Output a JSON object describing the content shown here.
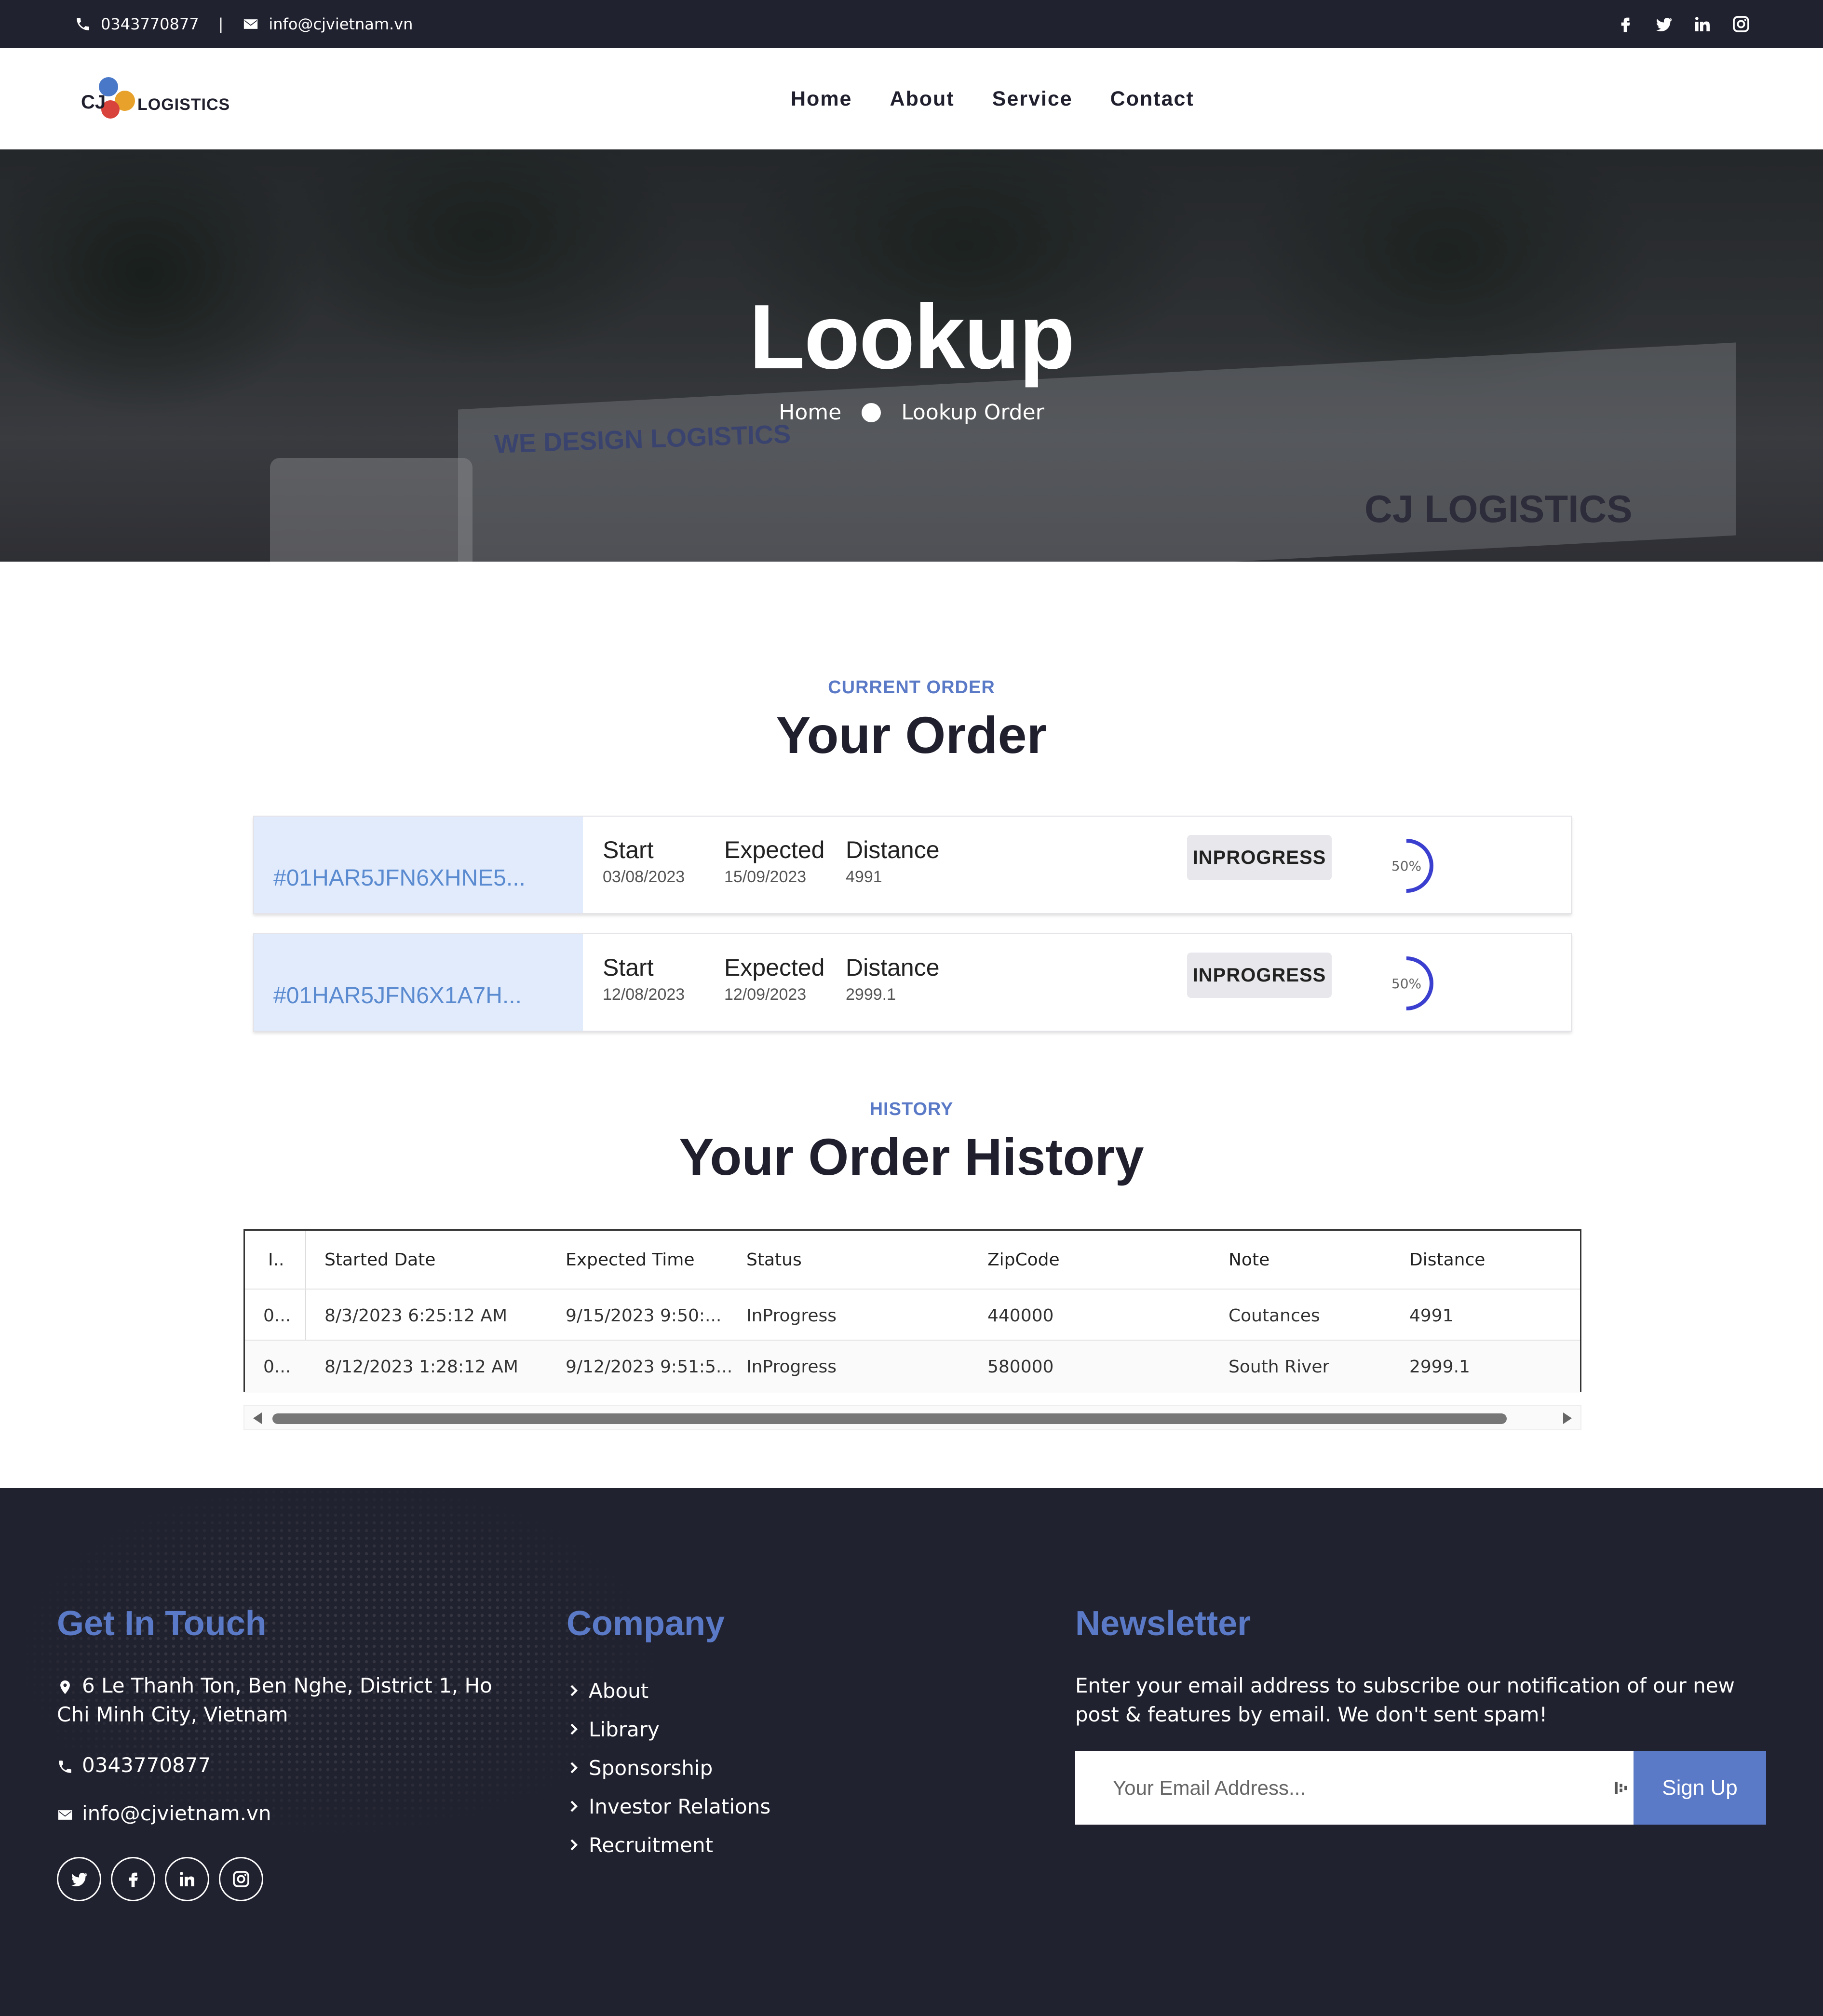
{
  "topbar": {
    "phone": "0343770877",
    "separator": "|",
    "email": "info@cjvietnam.vn",
    "social_icons": [
      "facebook-icon",
      "twitter-icon",
      "linkedin-icon",
      "instagram-icon"
    ]
  },
  "header": {
    "logo": {
      "mark": "CJ",
      "word": "LOGISTICS"
    },
    "nav": [
      "Home",
      "About",
      "Service",
      "Contact"
    ]
  },
  "hero": {
    "title": "Lookup",
    "breadcrumb": [
      "Home",
      "Lookup Order"
    ],
    "background_text": [
      "WE DESIGN LOGISTICS",
      "CJ LOGISTICS"
    ]
  },
  "current_order": {
    "kicker": "CURRENT ORDER",
    "title": "Your Order",
    "labels": {
      "start": "Start",
      "expected": "Expected",
      "distance": "Distance"
    },
    "orders": [
      {
        "id": "#01HAR5JFN6XHNE5...",
        "start": "03/08/2023",
        "expected": "15/09/2023",
        "distance": "4991",
        "status": "INPROGRESS",
        "progress_label": "50%",
        "progress": 0.5
      },
      {
        "id": "#01HAR5JFN6X1A7H...",
        "start": "12/08/2023",
        "expected": "12/09/2023",
        "distance": "2999.1",
        "status": "INPROGRESS",
        "progress_label": "50%",
        "progress": 0.5
      }
    ]
  },
  "history": {
    "kicker": "HISTORY",
    "title": "Your Order History",
    "columns": [
      "I..",
      "Started Date",
      "Expected Time",
      "Status",
      "ZipCode",
      "Note",
      "Distance"
    ],
    "rows": [
      [
        "0...",
        "8/3/2023 6:25:12 AM",
        "9/15/2023 9:50:...",
        "InProgress",
        "440000",
        "Coutances",
        "4991"
      ],
      [
        "0...",
        "8/12/2023 1:28:12 AM",
        "9/12/2023 9:51:5...",
        "InProgress",
        "580000",
        "South River",
        "2999.1"
      ]
    ]
  },
  "footer": {
    "get_in_touch": {
      "title": "Get In Touch",
      "address": "6 Le Thanh Ton, Ben Nghe, District 1, Ho Chi Minh City, Vietnam",
      "phone": "0343770877",
      "email": "info@cjvietnam.vn"
    },
    "company": {
      "title": "Company",
      "links": [
        "About",
        "Library",
        "Sponsorship",
        "Investor Relations",
        "Recruitment"
      ]
    },
    "newsletter": {
      "title": "Newsletter",
      "text": "Enter your email address to subscribe our notification of our new post & features by email. We don't sent spam!",
      "placeholder": "Your Email Address...",
      "button": "Sign Up"
    }
  },
  "colors": {
    "dark": "#21222f",
    "accent": "#5a79c6",
    "id_bg": "#e1ebfb",
    "progress": "#3b3fcf"
  }
}
